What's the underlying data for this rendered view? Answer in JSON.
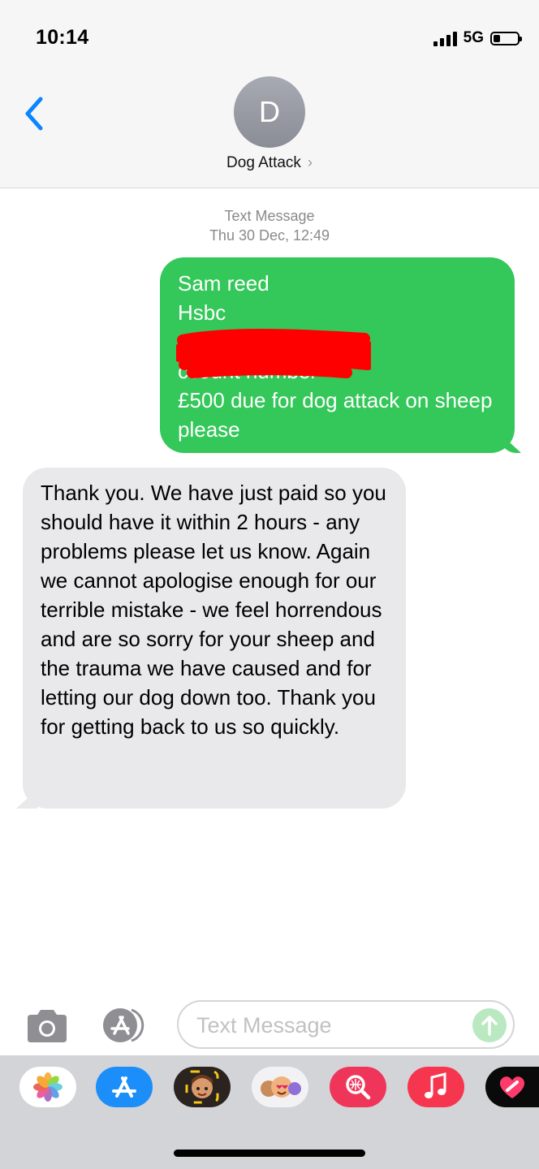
{
  "status_bar": {
    "time": "10:14",
    "network": "5G"
  },
  "header": {
    "avatar_initial": "D",
    "contact_name": "Dog Attack",
    "chevron": "›"
  },
  "conversation": {
    "service_label": "Text Message",
    "timestamp": "Thu 30 Dec, 12:49",
    "messages": [
      {
        "direction": "sent",
        "text": "Sam reed\nHsbc\n          sort code\n          ccount number\n£500 due for dog attack on sheep please",
        "redaction_color": "#ff0000"
      },
      {
        "direction": "received",
        "text": "Thank you. We have just paid so you should have it within 2 hours - any problems please let us know. Again we cannot apologise enough for our terrible mistake - we feel horrendous and are so sorry for your sheep and the trauma we have caused and for letting our dog down too. Thank you for getting back to us so quickly."
      }
    ]
  },
  "compose": {
    "placeholder": "Text Message"
  },
  "app_drawer": {
    "apps": [
      "photos-icon",
      "app-store-icon",
      "memoji-camera-icon",
      "memoji-stickers-icon",
      "web-search-icon",
      "music-icon",
      "digital-touch-icon"
    ]
  },
  "colors": {
    "sent_bubble": "#34c759",
    "received_bubble": "#e9e9eb",
    "accent": "#0a84ff"
  }
}
